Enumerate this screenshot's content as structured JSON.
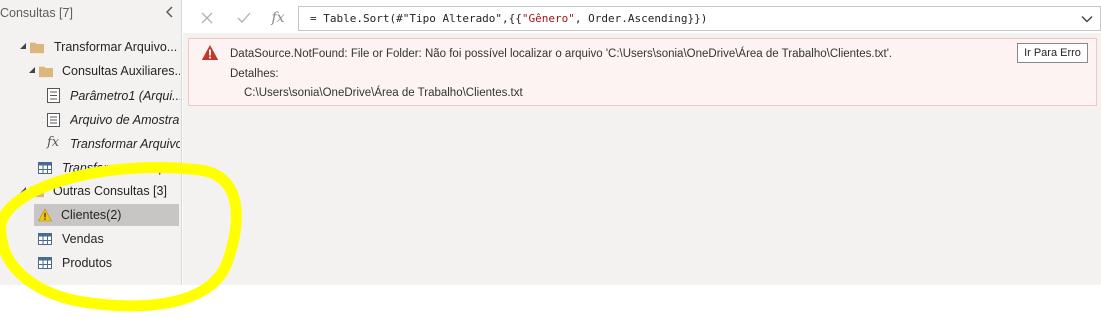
{
  "queries_pane": {
    "title": "Consultas [7]",
    "tree": [
      {
        "label": "Transformar Arquivo...",
        "kind": "folder",
        "expanded": true,
        "italic": false
      },
      {
        "label": "Consultas Auxiliares...",
        "kind": "folder",
        "expanded": true,
        "italic": false
      },
      {
        "label": "Parâmetro1 (Arqui...",
        "kind": "parameter",
        "italic": true
      },
      {
        "label": "Arquivo de Amostra",
        "kind": "list",
        "italic": true
      },
      {
        "label": "Transformar Arquivo",
        "kind": "function",
        "italic": true
      },
      {
        "label": "Transformar o Arqui...",
        "kind": "table",
        "italic": true
      },
      {
        "label": "Outras Consultas [3]",
        "kind": "folder",
        "expanded": true,
        "italic": false
      },
      {
        "label": "Clientes(2)",
        "kind": "warning",
        "italic": false,
        "selected": true
      },
      {
        "label": "Vendas",
        "kind": "table",
        "italic": false
      },
      {
        "label": "Produtos",
        "kind": "table",
        "italic": false
      }
    ]
  },
  "formula_bar": {
    "prefix": "= Table.Sort(#\"Tipo Alterado\",{{",
    "string_literal": "\"Gênero\"",
    "suffix": ", Order.Ascending}})"
  },
  "error": {
    "message": "DataSource.NotFound: File or Folder: Não foi possível localizar o arquivo 'C:\\Users\\sonia\\OneDrive\\Área de Trabalho\\Clientes.txt'.",
    "details_label": "Detalhes:",
    "details_path": "C:\\Users\\sonia\\OneDrive\\Área de Trabalho\\Clientes.txt",
    "goto_button": "Ir Para Erro"
  },
  "colors": {
    "folder": "#dcb67a",
    "error_icon": "#c0392b",
    "annotation": "#ffff00",
    "selected_row": "#c8c6c4"
  }
}
